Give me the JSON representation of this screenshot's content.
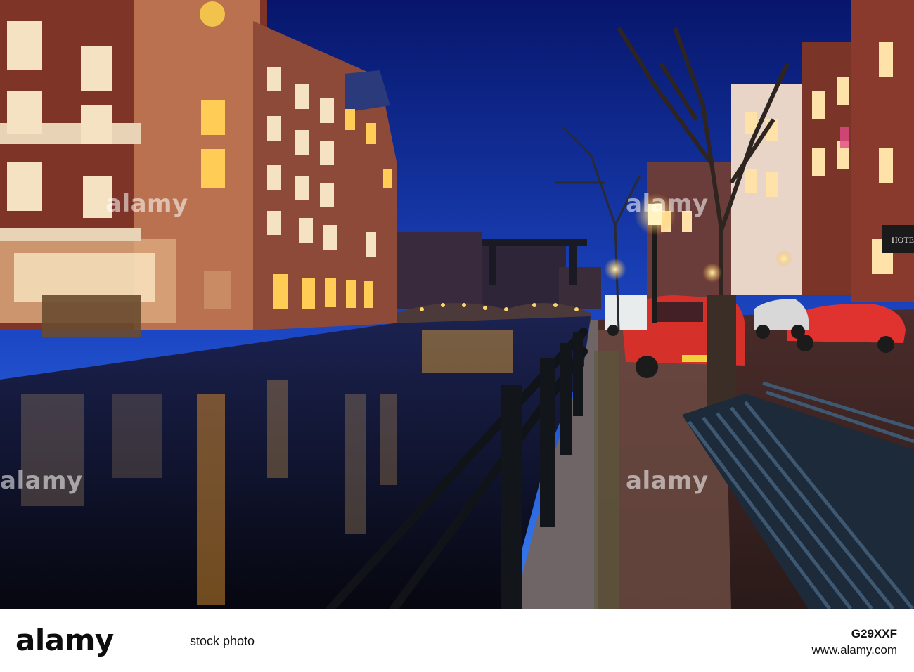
{
  "scene": {
    "description_tag": "amsterdam-canal-night"
  },
  "signage": {
    "hotel_sign": "HOTE"
  },
  "watermark": {
    "text": "alamy"
  },
  "footer": {
    "logo": "alamy",
    "stock_line": "stock photo",
    "image_id": "G29XXF",
    "site": "www.alamy.com"
  },
  "colors": {
    "sky_top": "#0b1f7a",
    "sky_bottom": "#2d6ee8",
    "brick": "#8a3a2c",
    "facade_light": "#e8c7a6",
    "car_red": "#d6302b",
    "water": "#0a0f24"
  }
}
